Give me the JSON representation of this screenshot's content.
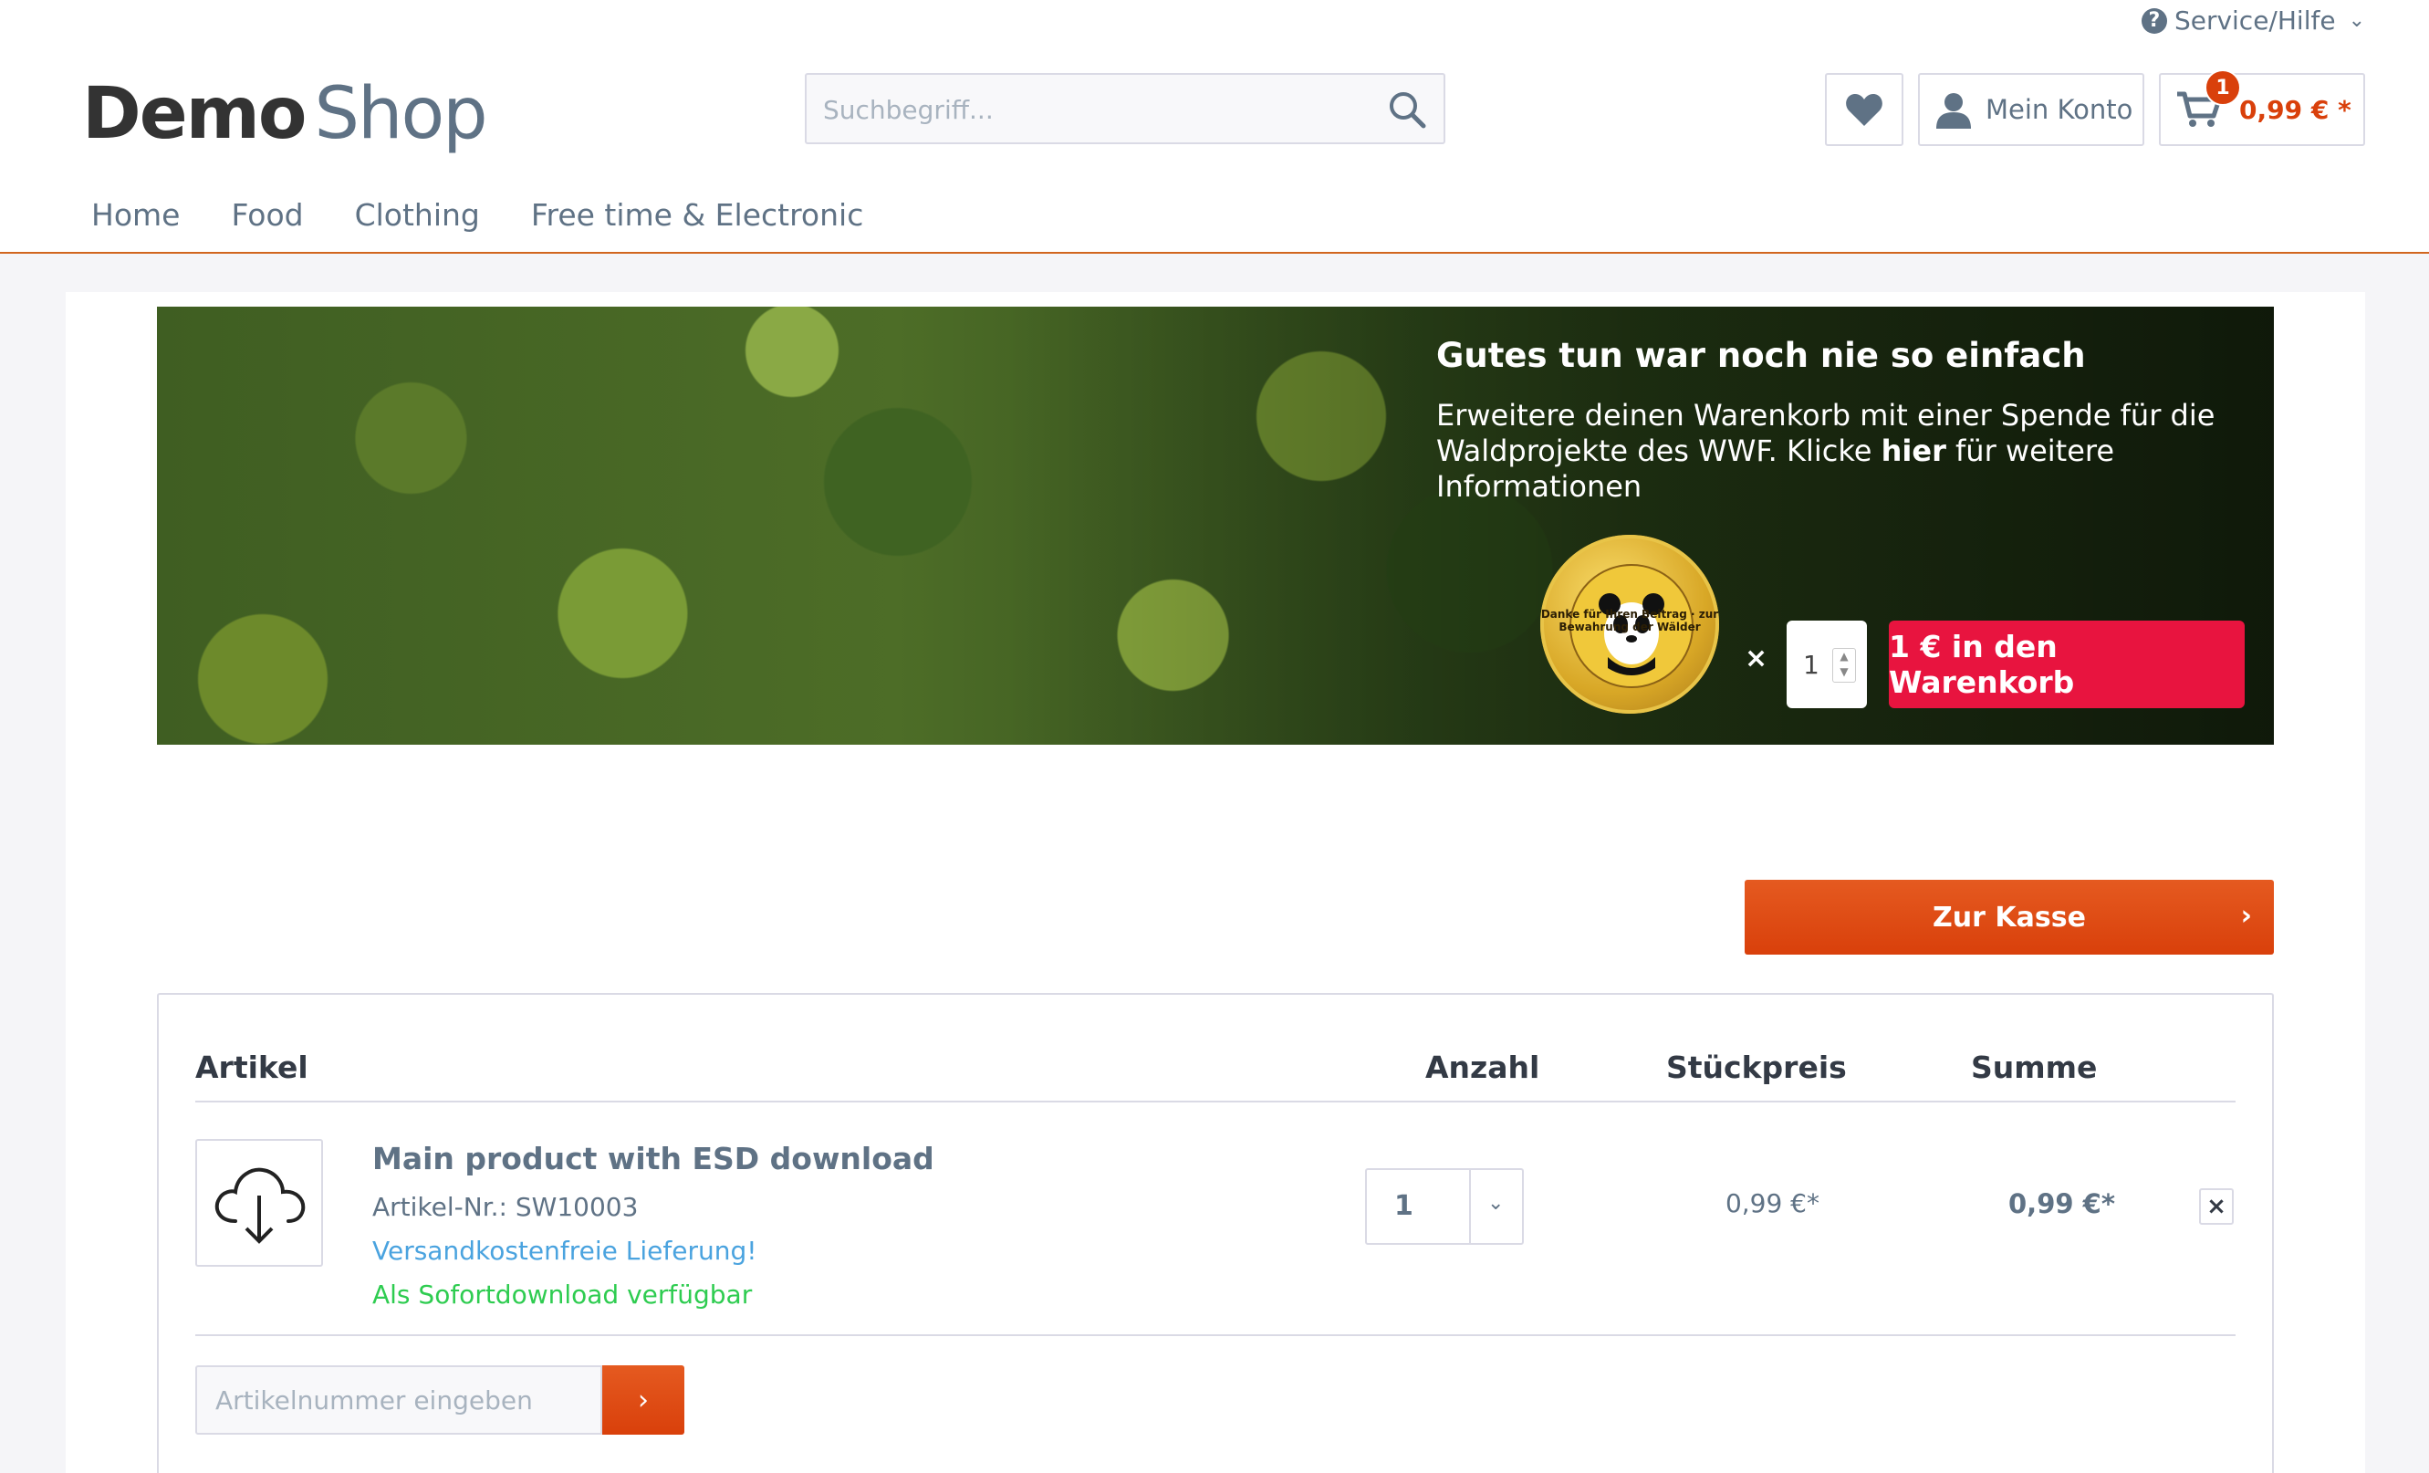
{
  "header": {
    "service_label": "Service/Hilfe",
    "logo_part1": "Demo",
    "logo_part2": "Shop",
    "search_placeholder": "Suchbegriff...",
    "account_label": "Mein Konto",
    "cart_count": "1",
    "cart_total": "0,99 € *"
  },
  "nav": {
    "items": [
      "Home",
      "Food",
      "Clothing",
      "Free time & Electronic"
    ]
  },
  "banner": {
    "title": "Gutes tun war noch nie so einfach",
    "text_part1": "Erweitere deinen Warenkorb mit einer Spende für die Waldprojekte des WWF. Klicke ",
    "text_bold": "hier",
    "text_part2": " für weitere Informationen",
    "seal_text": "Danke für Ihren Beitrag · zur Bewahrung der Wälder",
    "times": "×",
    "quantity": "1",
    "donate_button": "1 € in den Warenkorb"
  },
  "checkout_button": "Zur Kasse",
  "table": {
    "headers": {
      "article": "Artikel",
      "quantity": "Anzahl",
      "unit_price": "Stückpreis",
      "total": "Summe"
    },
    "items": [
      {
        "name": "Main product with ESD download",
        "number": "Artikel-Nr.: SW10003",
        "shipping": "Versandkostenfreie Lieferung!",
        "availability": "Als Sofortdownload verfügbar",
        "quantity": "1",
        "unit_price": "0,99 €*",
        "total": "0,99 €*"
      }
    ],
    "article_input_placeholder": "Artikelnummer eingeben"
  },
  "colors": {
    "accent": "#d9400b",
    "donate": "#e8143f",
    "link_blue": "#4aa3df",
    "available_green": "#2ecc50",
    "text": "#5f7285"
  }
}
